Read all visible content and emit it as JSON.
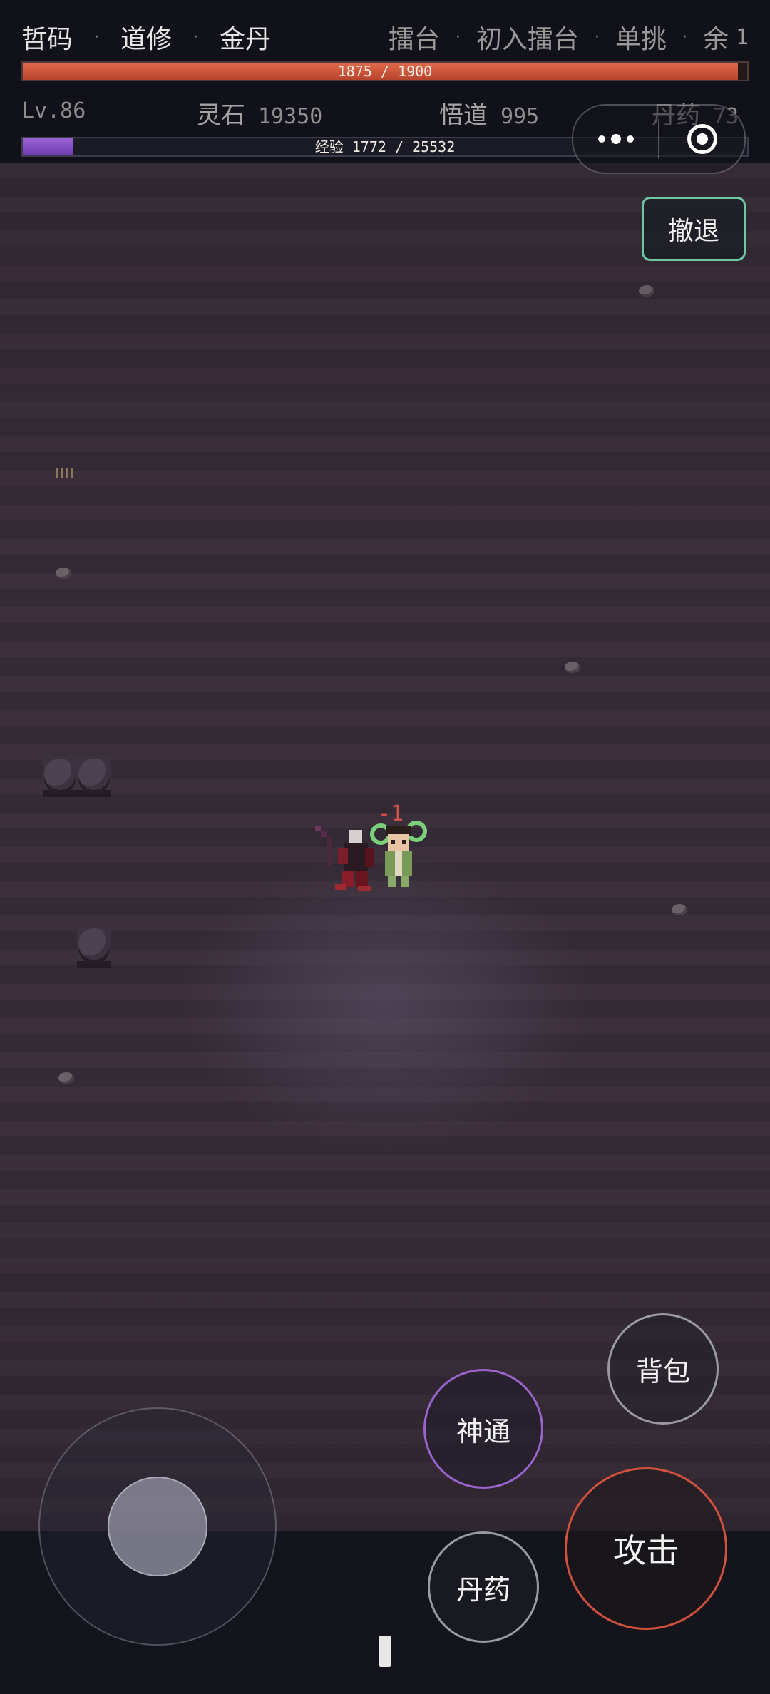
{
  "header": {
    "config": [
      "哲码",
      "道修",
      "金丹"
    ],
    "modes": [
      "擂台",
      "初入擂台",
      "单挑"
    ],
    "remaining_label": "余",
    "remaining_value": "1"
  },
  "hp": {
    "current": 1875,
    "max": 1900,
    "text": "1875 / 1900"
  },
  "stats": {
    "level": "Lv.86",
    "lingshi_label": "灵石",
    "lingshi_value": "19350",
    "wudao_label": "悟道",
    "wudao_value": "995",
    "danyao_label": "丹药",
    "danyao_value": "73"
  },
  "exp": {
    "current": 1772,
    "max": 25532,
    "text": "经验 1772 / 25532"
  },
  "buttons": {
    "retreat": "撤退",
    "bag": "背包",
    "skill": "神通",
    "attack": "攻击",
    "pill": "丹药"
  },
  "battle": {
    "damage_text": "-1"
  },
  "colors": {
    "hp": "#e06a4a",
    "exp": "#9a62d6",
    "retreat_border": "#6fc7a6",
    "skill_border": "#9a64cc",
    "attack_border": "#d2503e"
  }
}
